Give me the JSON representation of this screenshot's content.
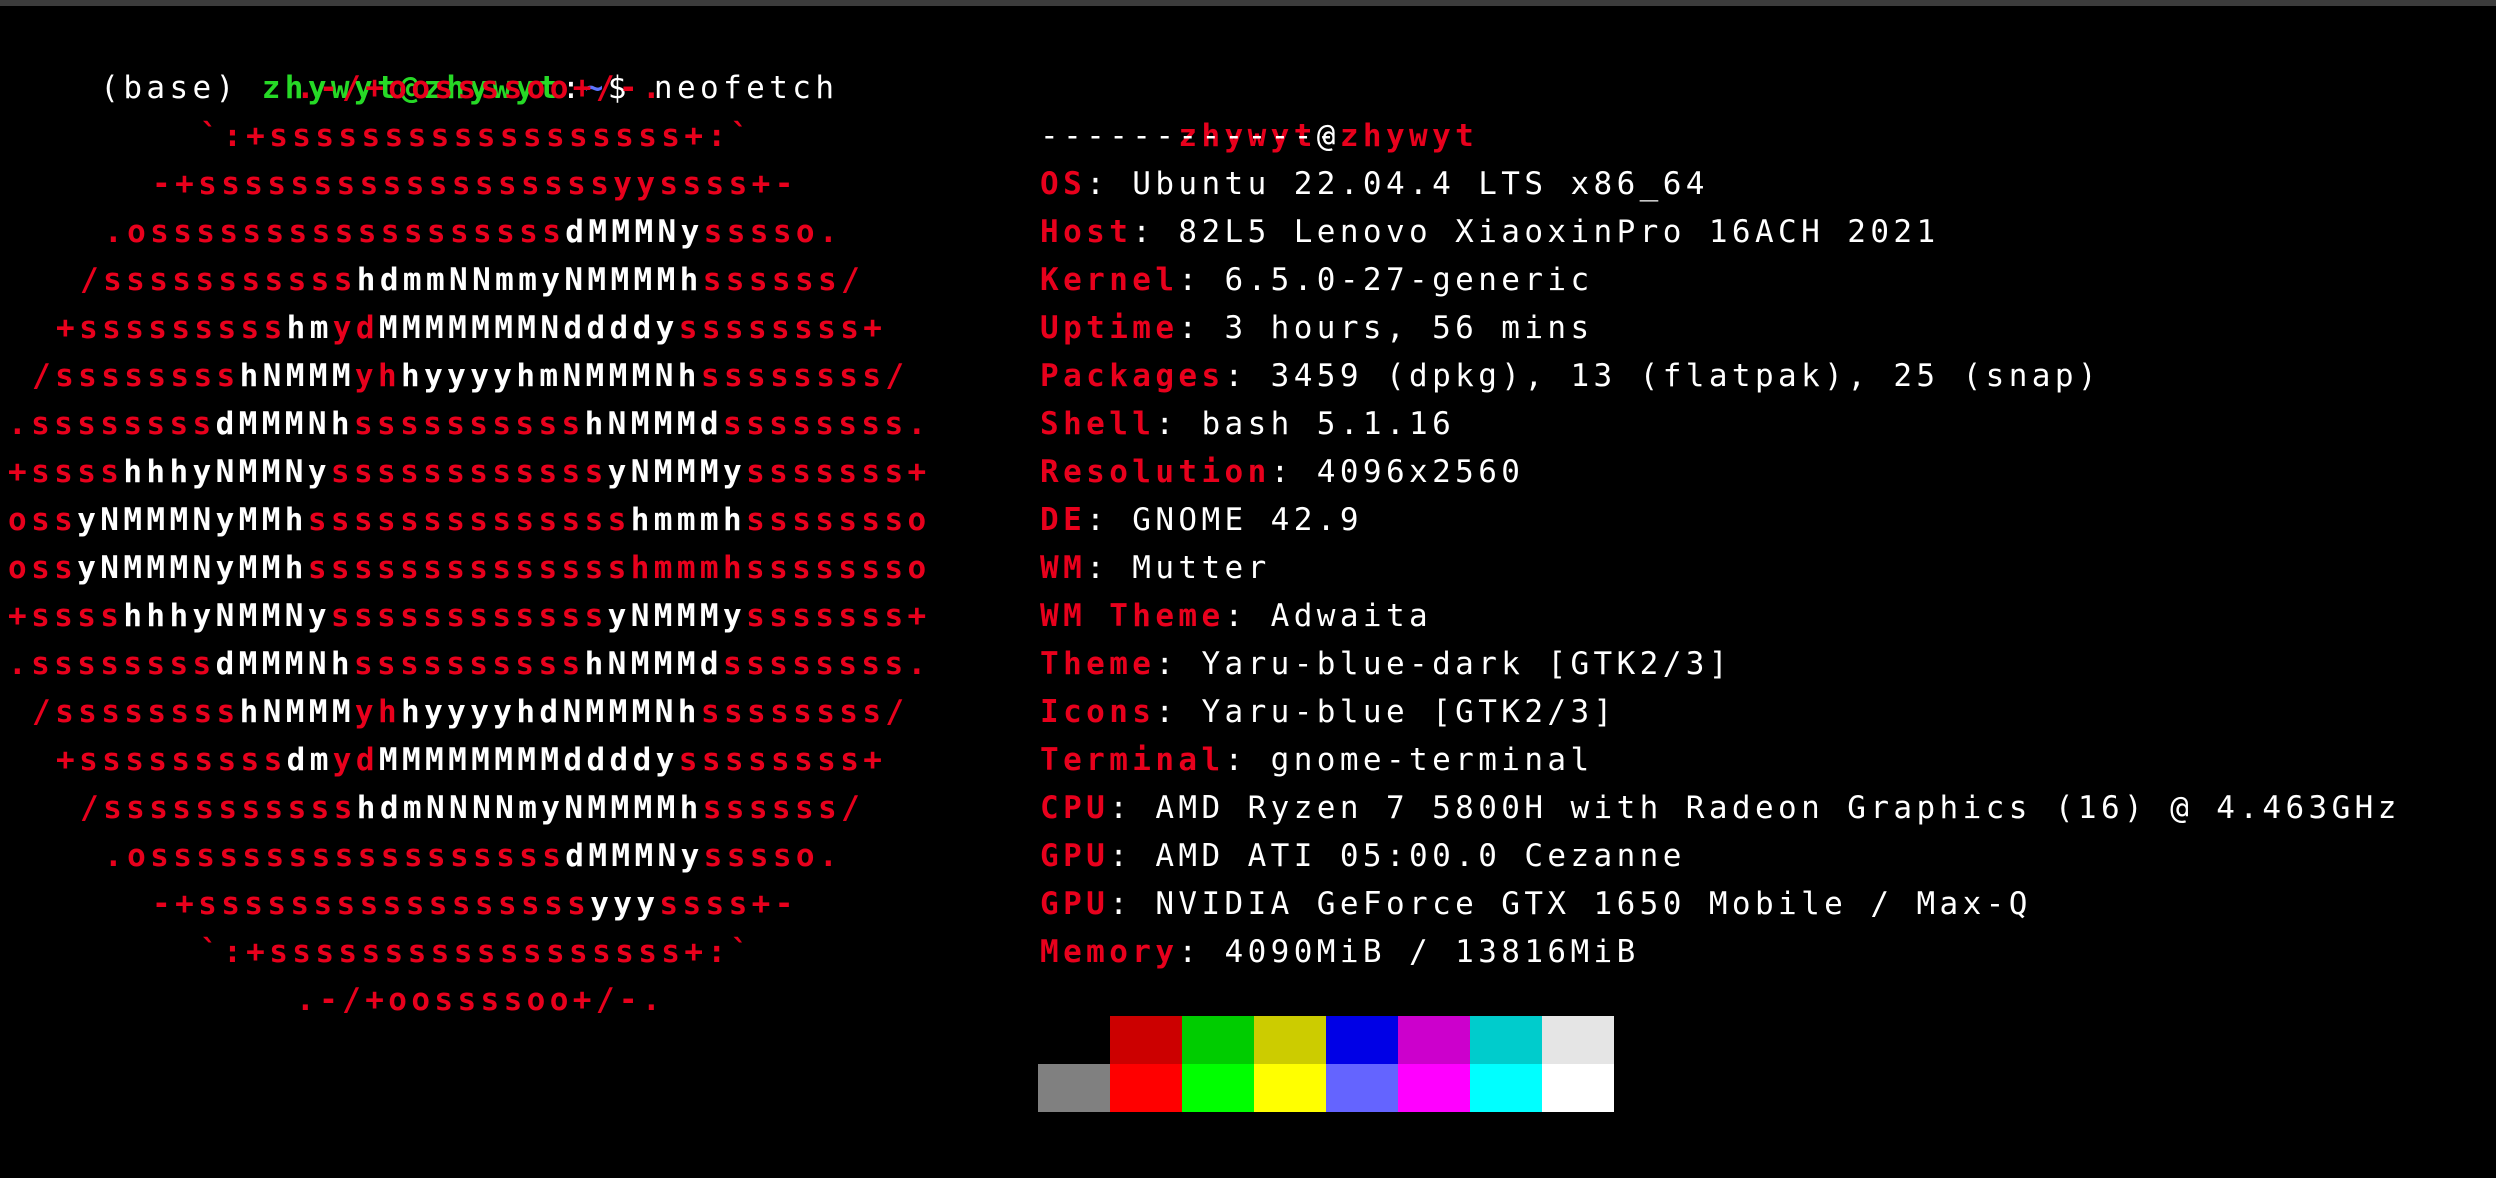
{
  "prompt": {
    "env": "(base) ",
    "user": "zhywyt",
    "at": "@",
    "host": "zhywyt",
    "colon": ":",
    "path": "~",
    "dollar": "$ ",
    "command": "neofetch"
  },
  "logo": {
    "lines": [
      [
        {
          "t": "         .-/+oossssoo+/-.",
          "c": "r"
        }
      ],
      [
        {
          "t": "     `:+ssssssssssssssssss+:`",
          "c": "r"
        }
      ],
      [
        {
          "t": "   -+ssssssssssssssssssyyssss+-",
          "c": "r"
        }
      ],
      [
        {
          "t": " .ossssssssssssssssss",
          "c": "r"
        },
        {
          "t": "dMMMNy",
          "c": "w"
        },
        {
          "t": "sssso.",
          "c": "r"
        }
      ],
      [
        {
          "t": "/sssssssssss",
          "c": "r"
        },
        {
          "t": "hdmmNNmmyNMMMMh",
          "c": "w"
        },
        {
          "t": "ssssss/",
          "c": "r"
        }
      ],
      [
        {
          "t": "+sssssssss",
          "c": "r"
        },
        {
          "t": "hm",
          "c": "w"
        },
        {
          "t": "yd",
          "c": "r"
        },
        {
          "t": "MMMMMMMNddddy",
          "c": "w"
        },
        {
          "t": "ssssssss+",
          "c": "r"
        }
      ],
      [
        {
          "t": "/ssssssss",
          "c": "r"
        },
        {
          "t": "hNMMM",
          "c": "w"
        },
        {
          "t": "yh",
          "c": "r"
        },
        {
          "t": "hyyyyhmNMMMNh",
          "c": "w"
        },
        {
          "t": "ssssssss/",
          "c": "r"
        }
      ],
      [
        {
          "t": ".ssssssss",
          "c": "r"
        },
        {
          "t": "dMMMNh",
          "c": "w"
        },
        {
          "t": "ssssssssss",
          "c": "r"
        },
        {
          "t": "hNMMMd",
          "c": "w"
        },
        {
          "t": "ssssssss.",
          "c": "r"
        }
      ],
      [
        {
          "t": "+ssss",
          "c": "r"
        },
        {
          "t": "hhhyNMMNy",
          "c": "w"
        },
        {
          "t": "ssssssssssss",
          "c": "r"
        },
        {
          "t": "yNMMMy",
          "c": "w"
        },
        {
          "t": "sssssss+",
          "c": "r"
        }
      ],
      [
        {
          "t": "oss",
          "c": "r"
        },
        {
          "t": "yNMMMNyMMh",
          "c": "w"
        },
        {
          "t": "ssssssssssssss",
          "c": "r"
        },
        {
          "t": "hmmmh",
          "c": "w"
        },
        {
          "t": "ssssssso",
          "c": "r"
        }
      ],
      [
        {
          "t": "oss",
          "c": "r"
        },
        {
          "t": "yNMMMNyMMh",
          "c": "w"
        },
        {
          "t": "sssssssssssssshmmmhssssssso",
          "c": "r"
        }
      ],
      [
        {
          "t": "+ssss",
          "c": "r"
        },
        {
          "t": "hhhyNMMNy",
          "c": "w"
        },
        {
          "t": "ssssssssssss",
          "c": "r"
        },
        {
          "t": "yNMMMy",
          "c": "w"
        },
        {
          "t": "sssssss+",
          "c": "r"
        }
      ],
      [
        {
          "t": ".ssssssss",
          "c": "r"
        },
        {
          "t": "dMMMNh",
          "c": "w"
        },
        {
          "t": "ssssssssss",
          "c": "r"
        },
        {
          "t": "hNMMMd",
          "c": "w"
        },
        {
          "t": "ssssssss.",
          "c": "r"
        }
      ],
      [
        {
          "t": "/ssssssss",
          "c": "r"
        },
        {
          "t": "hNMMM",
          "c": "w"
        },
        {
          "t": "yh",
          "c": "r"
        },
        {
          "t": "hyyyyhdNMMMNh",
          "c": "w"
        },
        {
          "t": "ssssssss/",
          "c": "r"
        }
      ],
      [
        {
          "t": "+sssssssss",
          "c": "r"
        },
        {
          "t": "dm",
          "c": "w"
        },
        {
          "t": "yd",
          "c": "r"
        },
        {
          "t": "MMMMMMMMddddy",
          "c": "w"
        },
        {
          "t": "ssssssss+",
          "c": "r"
        }
      ],
      [
        {
          "t": "/sssssssssss",
          "c": "r"
        },
        {
          "t": "hdmNNNNmyNMMMMh",
          "c": "w"
        },
        {
          "t": "ssssss/",
          "c": "r"
        }
      ],
      [
        {
          "t": " .ossssssssssssssssss",
          "c": "r"
        },
        {
          "t": "dMMMNy",
          "c": "w"
        },
        {
          "t": "sssso.",
          "c": "r"
        }
      ],
      [
        {
          "t": "   -+sssssssssssssssss",
          "c": "r"
        },
        {
          "t": "yyy",
          "c": "w"
        },
        {
          "t": "ssss+-",
          "c": "r"
        }
      ],
      [
        {
          "t": "     `:+ssssssssssssssssss+:`",
          "c": "r"
        }
      ],
      [
        {
          "t": "         .-/+oossssoo+/-.",
          "c": "r"
        }
      ]
    ]
  },
  "info": {
    "user": "zhywyt",
    "at": "@",
    "host": "zhywyt",
    "divider": "-------------",
    "rows": [
      {
        "key": "OS",
        "value": "Ubuntu 22.04.4 LTS x86_64"
      },
      {
        "key": "Host",
        "value": "82L5 Lenovo XiaoxinPro 16ACH 2021"
      },
      {
        "key": "Kernel",
        "value": "6.5.0-27-generic"
      },
      {
        "key": "Uptime",
        "value": "3 hours, 56 mins"
      },
      {
        "key": "Packages",
        "value": "3459 (dpkg), 13 (flatpak), 25 (snap)"
      },
      {
        "key": "Shell",
        "value": "bash 5.1.16"
      },
      {
        "key": "Resolution",
        "value": "4096x2560"
      },
      {
        "key": "DE",
        "value": "GNOME 42.9"
      },
      {
        "key": "WM",
        "value": "Mutter"
      },
      {
        "key": "WM Theme",
        "value": "Adwaita"
      },
      {
        "key": "Theme",
        "value": "Yaru-blue-dark [GTK2/3]"
      },
      {
        "key": "Icons",
        "value": "Yaru-blue [GTK2/3]"
      },
      {
        "key": "Terminal",
        "value": "gnome-terminal"
      },
      {
        "key": "CPU",
        "value": "AMD Ryzen 7 5800H with Radeon Graphics (16) @ 4.463GHz"
      },
      {
        "key": "GPU",
        "value": "AMD ATI 05:00.0 Cezanne"
      },
      {
        "key": "GPU",
        "value": "NVIDIA GeForce GTX 1650 Mobile / Max-Q"
      },
      {
        "key": "Memory",
        "value": "4090MiB / 13816MiB"
      }
    ],
    "separator": ": "
  },
  "palette": {
    "row1": [
      "#000000",
      "#cc0000",
      "#00cc00",
      "#cccc00",
      "#0000e6",
      "#cc00cc",
      "#00cccc",
      "#e5e5e5"
    ],
    "row2": [
      "#808080",
      "#ff0000",
      "#00ff00",
      "#ffff00",
      "#6464ff",
      "#ff00ff",
      "#00ffff",
      "#ffffff"
    ]
  },
  "colors": {
    "background": "#000000",
    "accent_red": "#e8001c",
    "prompt_green": "#26d926",
    "prompt_blue": "#5c74ff"
  }
}
